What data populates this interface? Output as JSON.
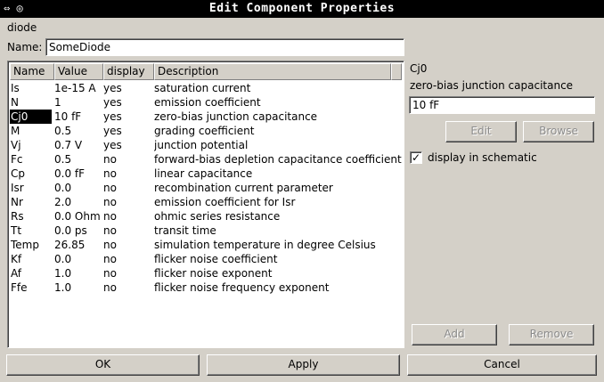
{
  "window": {
    "title": "Edit Component Properties",
    "icons": "⇔ ◎"
  },
  "component_type": "diode",
  "name_label": "Name:",
  "name_value": "SomeDiode",
  "columns": [
    "Name",
    "Value",
    "display",
    "Description"
  ],
  "rows": [
    {
      "name": "Is",
      "value": "1e-15 A",
      "display": "yes",
      "desc": "saturation current"
    },
    {
      "name": "N",
      "value": "1",
      "display": "yes",
      "desc": "emission coefficient"
    },
    {
      "name": "Cj0",
      "value": "10 fF",
      "display": "yes",
      "desc": "zero-bias junction capacitance",
      "selected": true
    },
    {
      "name": "M",
      "value": "0.5",
      "display": "yes",
      "desc": "grading coefficient"
    },
    {
      "name": "Vj",
      "value": "0.7 V",
      "display": "yes",
      "desc": "junction potential"
    },
    {
      "name": "Fc",
      "value": "0.5",
      "display": "no",
      "desc": "forward-bias depletion capacitance coefficient"
    },
    {
      "name": "Cp",
      "value": "0.0 fF",
      "display": "no",
      "desc": "linear capacitance"
    },
    {
      "name": "Isr",
      "value": "0.0",
      "display": "no",
      "desc": "recombination current parameter"
    },
    {
      "name": "Nr",
      "value": "2.0",
      "display": "no",
      "desc": "emission coefficient for Isr"
    },
    {
      "name": "Rs",
      "value": "0.0 Ohm",
      "display": "no",
      "desc": "ohmic series resistance"
    },
    {
      "name": "Tt",
      "value": "0.0 ps",
      "display": "no",
      "desc": "transit time"
    },
    {
      "name": "Temp",
      "value": "26.85",
      "display": "no",
      "desc": "simulation temperature in degree Celsius"
    },
    {
      "name": "Kf",
      "value": "0.0",
      "display": "no",
      "desc": "flicker noise coefficient"
    },
    {
      "name": "Af",
      "value": "1.0",
      "display": "no",
      "desc": "flicker noise exponent"
    },
    {
      "name": "Ffe",
      "value": "1.0",
      "display": "no",
      "desc": "flicker noise frequency exponent"
    }
  ],
  "selected": {
    "name": "Cj0",
    "description": "zero-bias junction capacitance",
    "value": "10 fF"
  },
  "buttons": {
    "edit": "Edit",
    "browse": "Browse",
    "add": "Add",
    "remove": "Remove",
    "ok": "OK",
    "apply": "Apply",
    "cancel": "Cancel"
  },
  "display_checkbox": {
    "label": "display in schematic",
    "checked": true,
    "mark": "✓"
  }
}
